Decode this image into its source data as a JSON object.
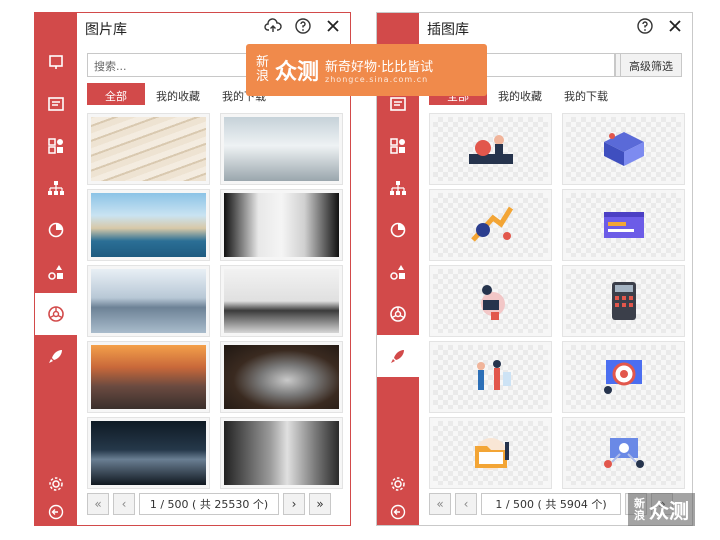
{
  "left": {
    "title": "图片库",
    "search_placeholder": "搜索...",
    "tabs": [
      "全部",
      "我的收藏",
      "我的下载"
    ],
    "page_text": "1 / 500 ( 共 25530 个)"
  },
  "right": {
    "title": "插图库",
    "filter_label": "高级筛选",
    "tabs": [
      "全部",
      "我的收藏",
      "我的下载"
    ],
    "page_text": "1 / 500 ( 共 5904 个)"
  },
  "watermark": {
    "brand_top": "新",
    "brand_bottom": "浪",
    "logo": "众测",
    "slogan": "新奇好物·比比皆试",
    "url": "zhongce.sina.com.cn"
  },
  "watermark2": {
    "top": "新",
    "bottom": "浪",
    "logo": "众测"
  },
  "colors": {
    "accent": "#d24a4a",
    "watermark": "#f08a4b"
  }
}
